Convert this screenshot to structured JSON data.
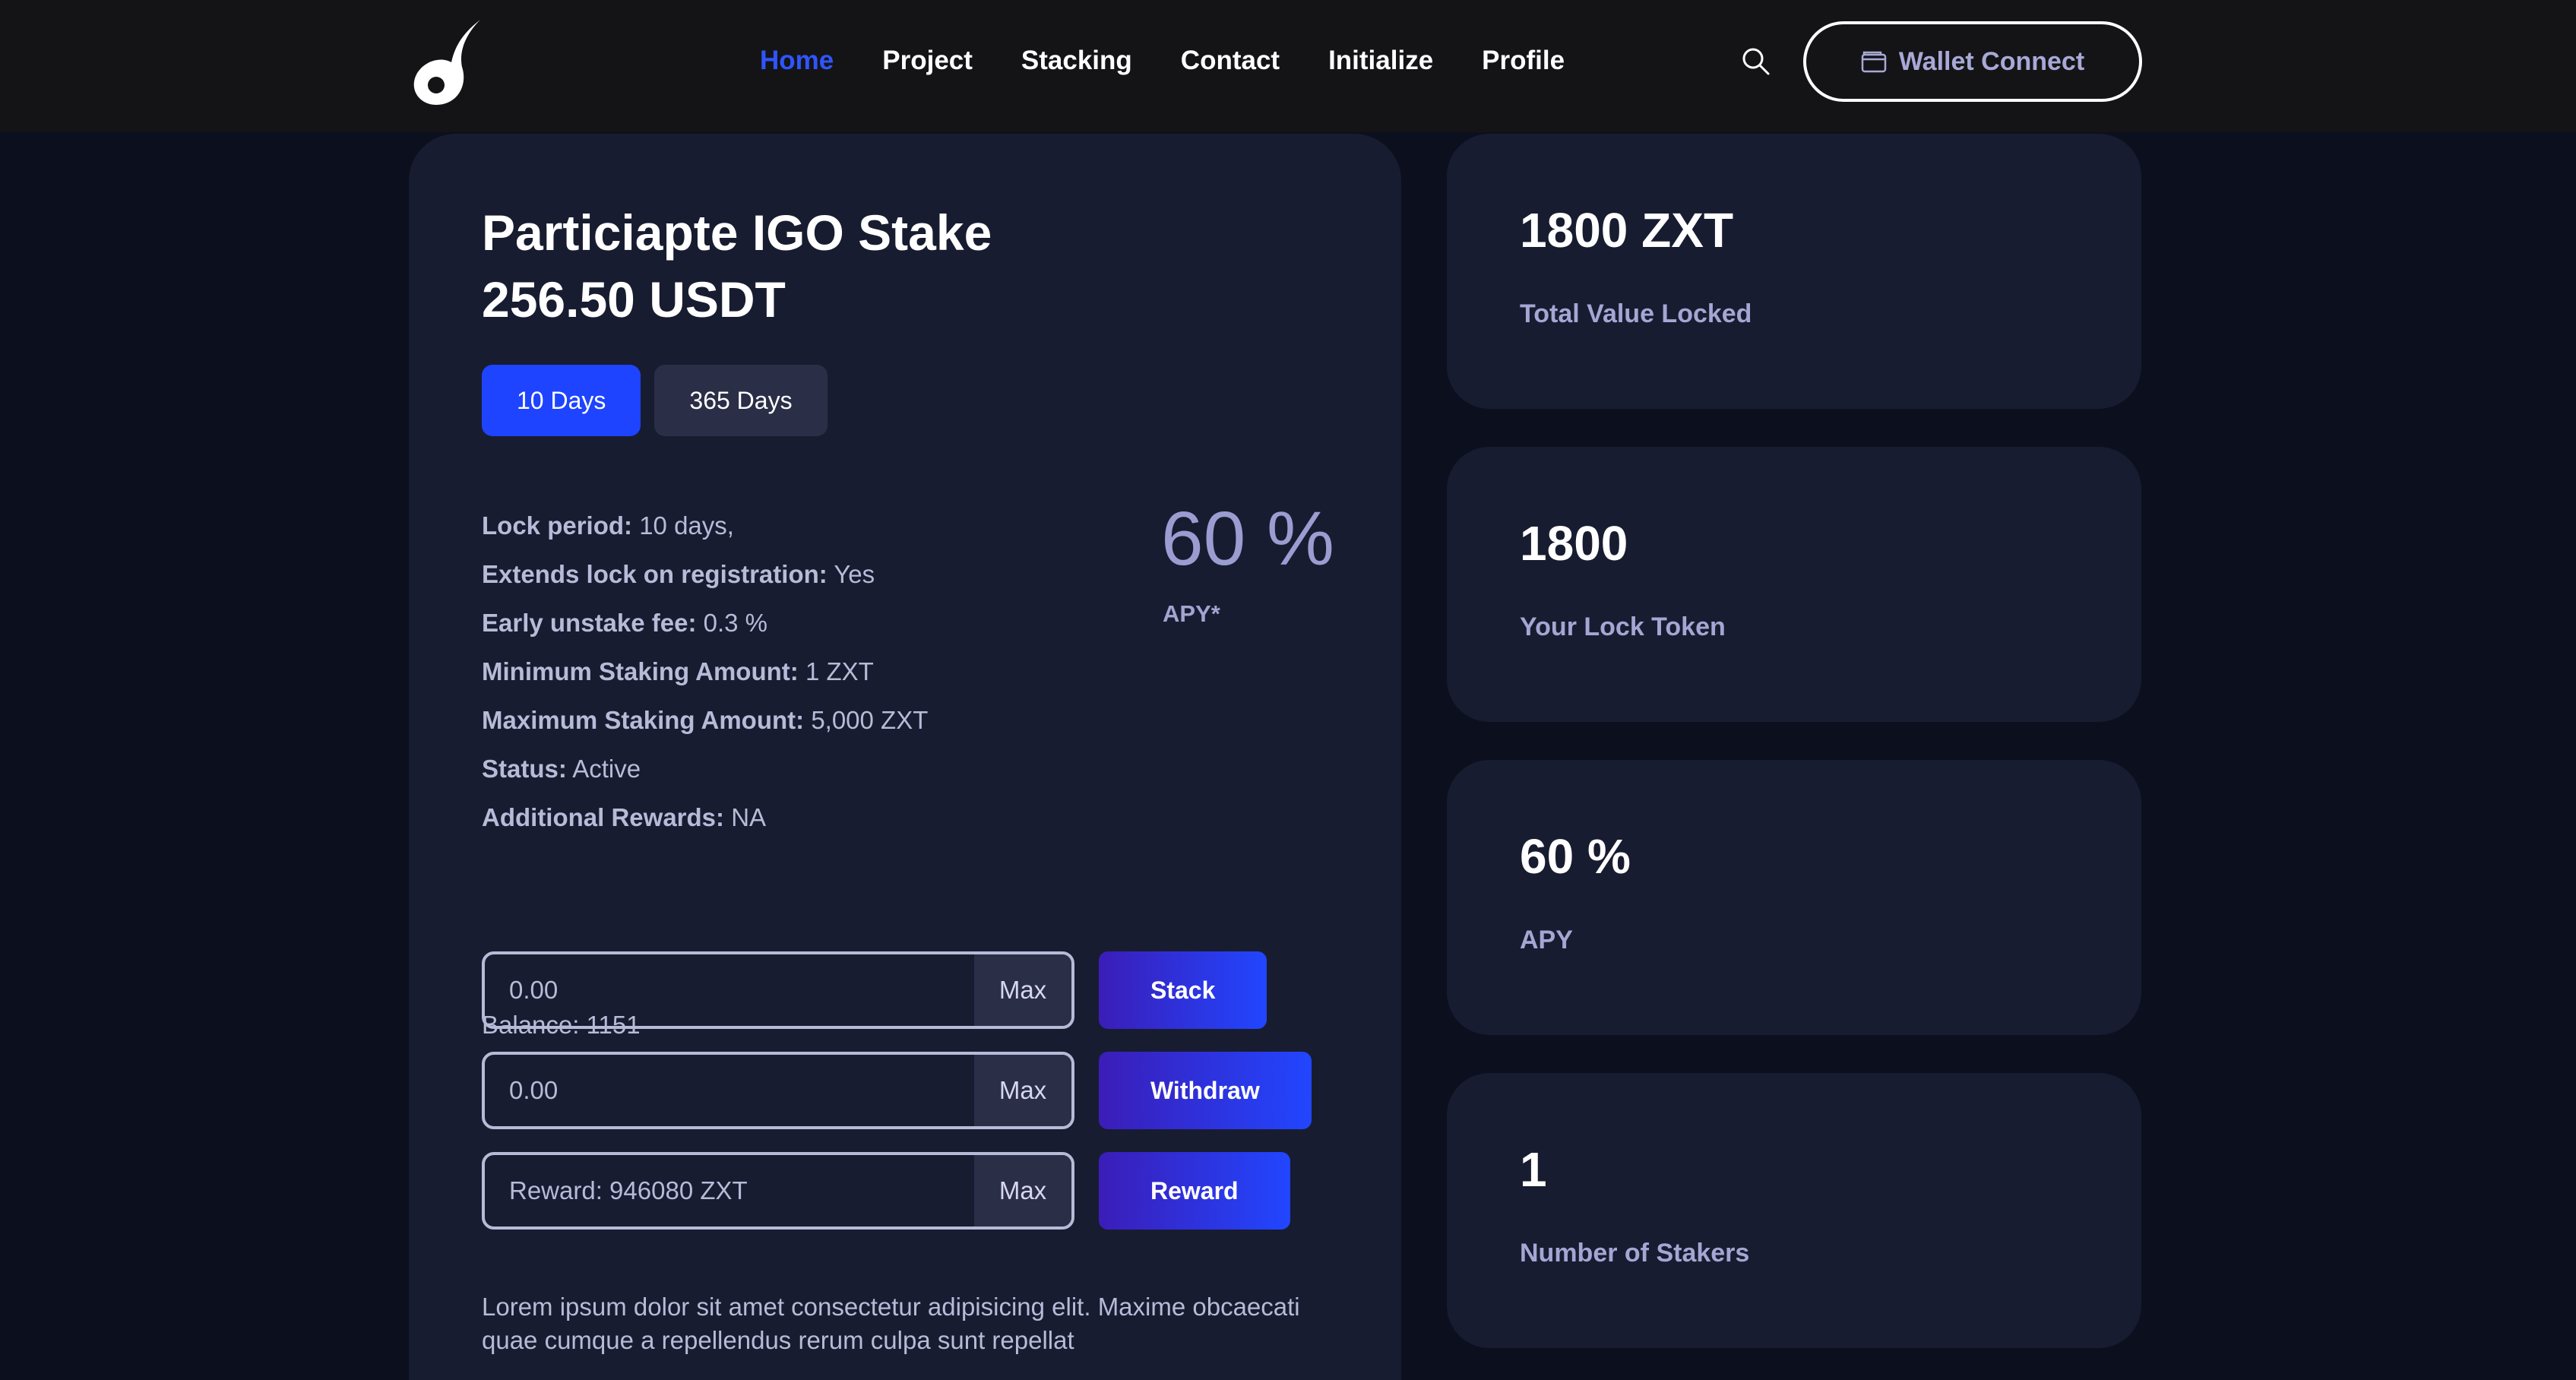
{
  "header": {
    "nav": [
      "Home",
      "Project",
      "Stacking",
      "Contact",
      "Initialize",
      "Profile"
    ],
    "active_nav": "Home",
    "wallet_label": "Wallet Connect"
  },
  "stake": {
    "title_line1": "Particiapte IGO Stake",
    "title_line2": "256.50 USDT",
    "tabs": [
      "10 Days",
      "365 Days"
    ],
    "active_tab": "10 Days",
    "details": [
      {
        "label": "Lock period:",
        "value": "10 days,"
      },
      {
        "label": "Extends lock on registration:",
        "value": "Yes"
      },
      {
        "label": "Early unstake fee:",
        "value": "0.3 %"
      },
      {
        "label": "Minimum Staking Amount:",
        "value": "1 ZXT"
      },
      {
        "label": "Maximum Staking Amount:",
        "value": "5,000 ZXT"
      },
      {
        "label": "Status:",
        "value": "Active"
      },
      {
        "label": "Additional Rewards:",
        "value": "NA"
      }
    ],
    "apy_value": "60 %",
    "apy_label": "APY*",
    "balance": "Balance: 1151",
    "stack_placeholder": "0.00",
    "withdraw_placeholder": "0.00",
    "reward_placeholder": "Reward: 946080 ZXT",
    "max_label": "Max",
    "stack_label": "Stack",
    "withdraw_label": "Withdraw",
    "reward_label": "Reward",
    "description": "Lorem ipsum dolor sit amet consectetur adipisicing elit. Maxime obcaecati quae cumque a repellendus rerum culpa sunt repellat"
  },
  "stats": [
    {
      "value": "1800 ZXT",
      "label": "Total Value Locked"
    },
    {
      "value": "1800",
      "label": "Your Lock Token"
    },
    {
      "value": "60 %",
      "label": "APY"
    },
    {
      "value": "1",
      "label": "Number of Stakers"
    }
  ],
  "colors": {
    "accent": "#1e44ff",
    "card": "#181c30",
    "background": "#0c0f1e"
  },
  "icons": [
    "flame-logo-icon",
    "search-icon",
    "wallet-icon"
  ]
}
